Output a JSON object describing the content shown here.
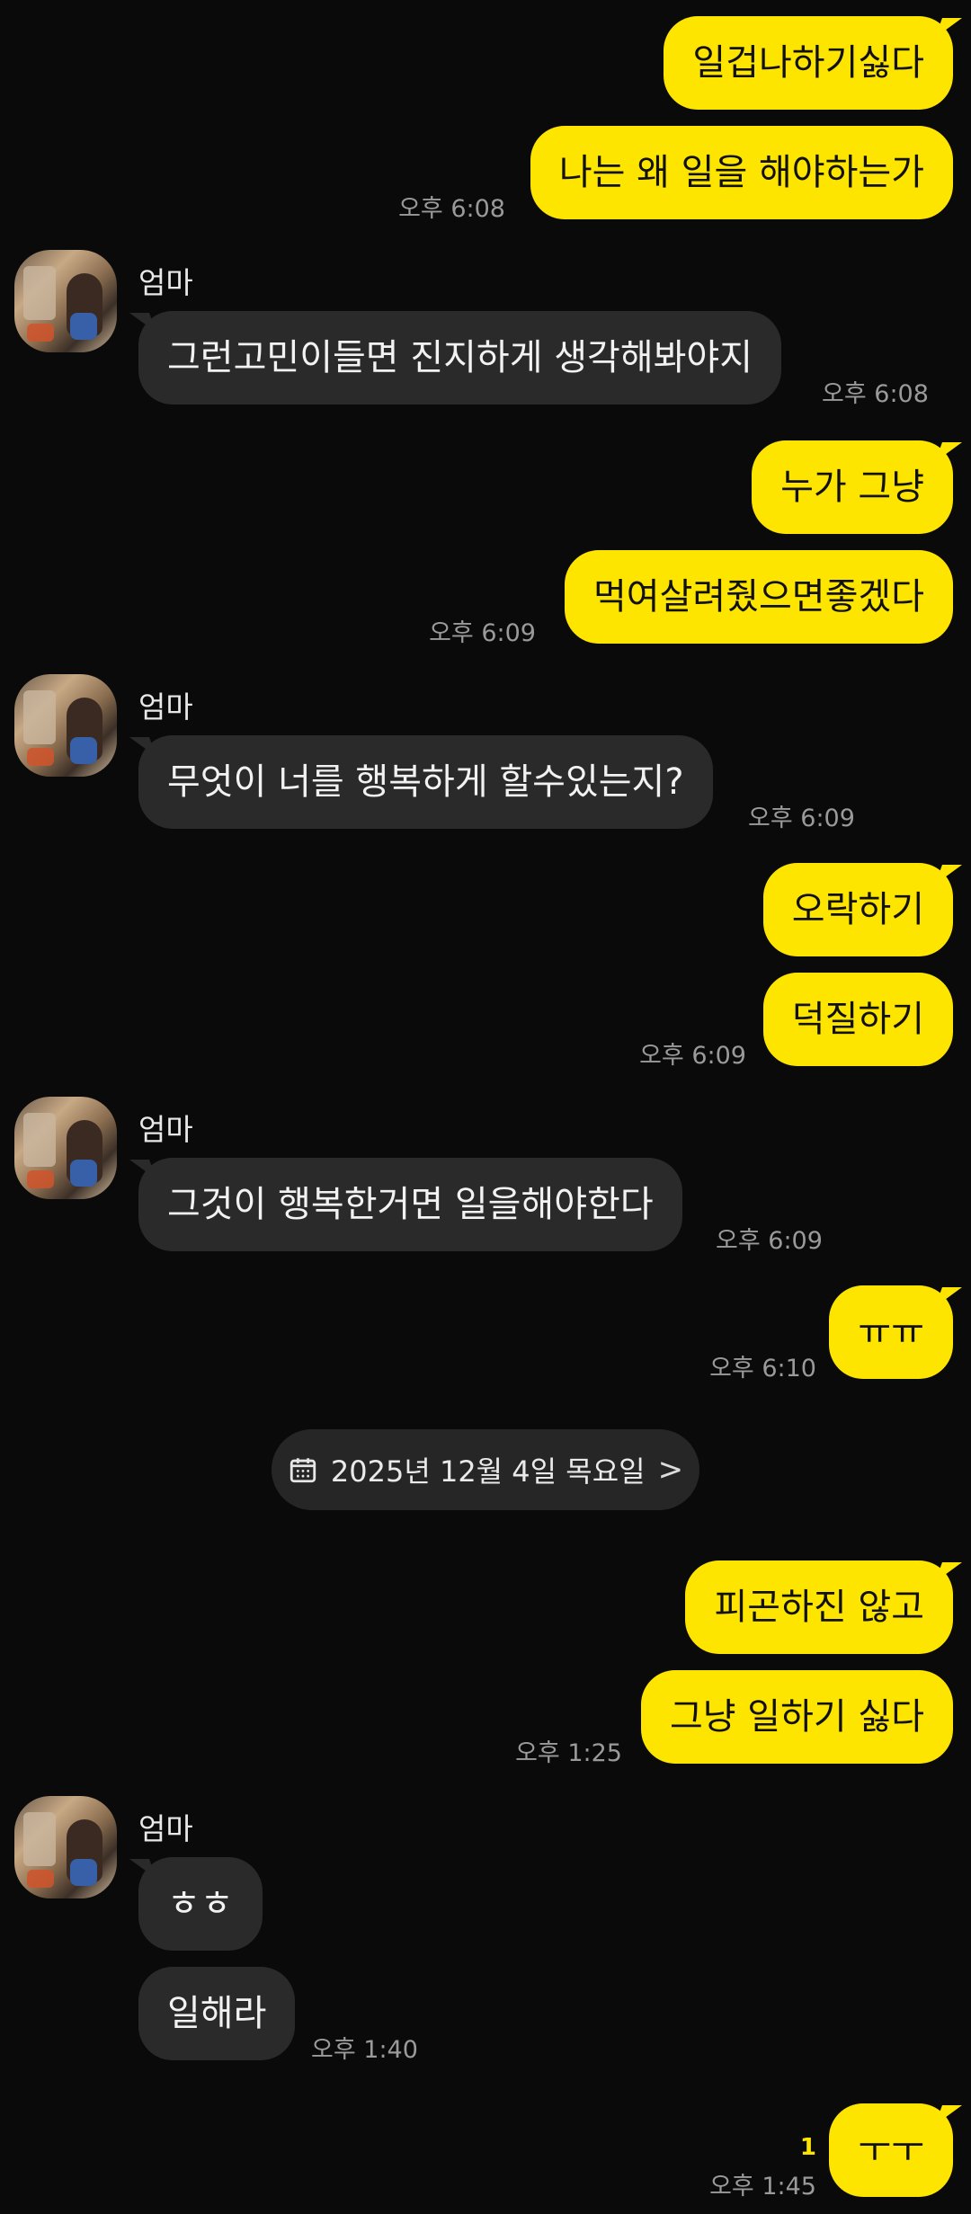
{
  "contact": {
    "name": "엄마"
  },
  "messages": [
    {
      "text": "일겁나하기싫다"
    },
    {
      "text": "나는 왜 일을 해야하는가",
      "time": "오후 6:08"
    },
    {
      "text": "그런고민이들면 진지하게 생각해봐야지",
      "time": "오후 6:08"
    },
    {
      "text": "누가 그냥"
    },
    {
      "text": "먹여살려줬으면좋겠다",
      "time": "오후 6:09"
    },
    {
      "text": "무엇이 너를 행복하게 할수있는지?",
      "time": "오후 6:09"
    },
    {
      "text": "오락하기"
    },
    {
      "text": "덕질하기",
      "time": "오후 6:09"
    },
    {
      "text": "그것이 행복한거면 일을해야한다",
      "time": "오후 6:09"
    },
    {
      "text": "ㅠㅠ",
      "time": "오후 6:10"
    },
    {
      "text": "피곤하진 않고"
    },
    {
      "text": "그냥 일하기 싫다",
      "time": "오후 1:25"
    },
    {
      "text": "ㅎㅎ"
    },
    {
      "text": "일해라",
      "time": "오후 1:40"
    },
    {
      "text": "ㅜㅜ",
      "time": "오후 1:45",
      "unread": "1"
    }
  ],
  "date_divider": {
    "text": "2025년 12월 4일 목요일",
    "icon": "calendar-icon",
    "chevron": ">"
  },
  "colors": {
    "my_bubble": "#fee500",
    "their_bubble": "#2a2a2a",
    "background": "#0a0a0a"
  }
}
